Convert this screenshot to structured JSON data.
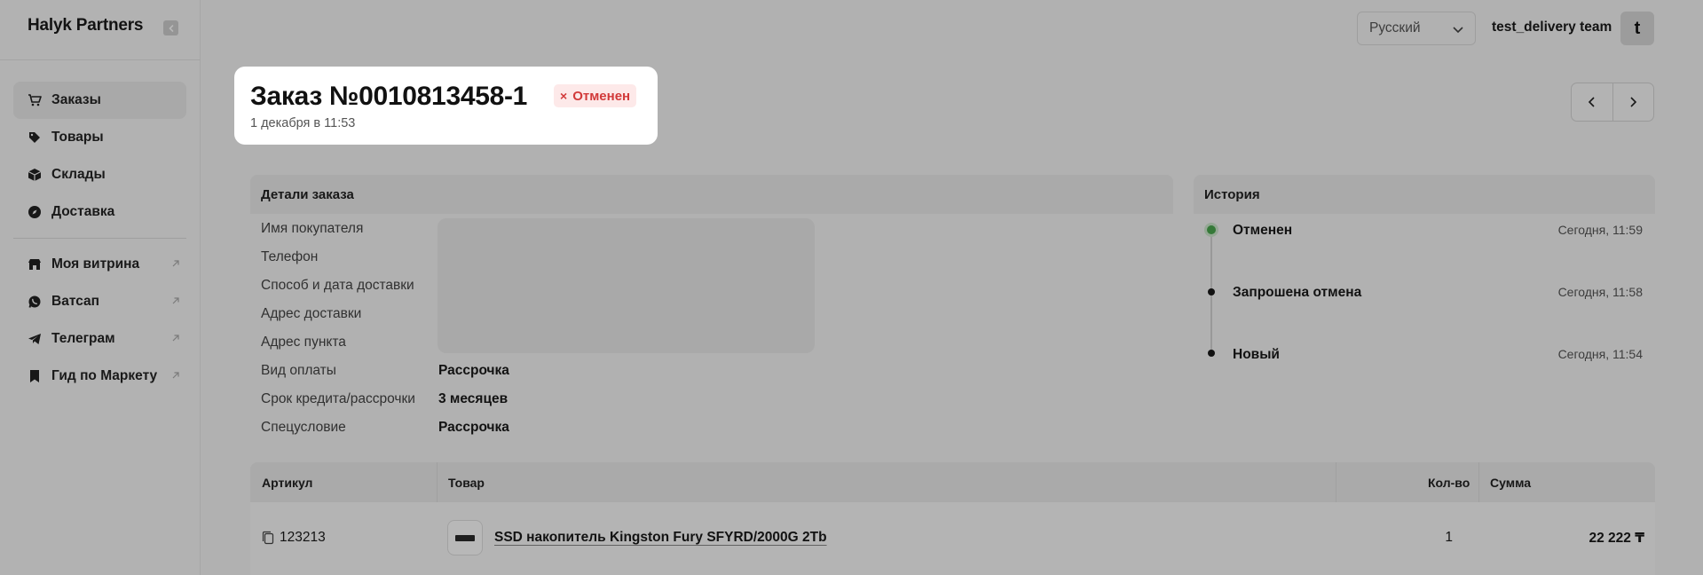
{
  "sidebar": {
    "brand": "Halyk Partners",
    "items": [
      {
        "label": "Заказы",
        "icon": "cart-icon",
        "active": true
      },
      {
        "label": "Товары",
        "icon": "tag-icon"
      },
      {
        "label": "Склады",
        "icon": "box-icon"
      },
      {
        "label": "Доставка",
        "icon": "compass-icon"
      }
    ],
    "links": [
      {
        "label": "Моя витрина",
        "icon": "store-icon"
      },
      {
        "label": "Ватсап",
        "icon": "whatsapp-icon"
      },
      {
        "label": "Телеграм",
        "icon": "telegram-icon"
      },
      {
        "label": "Гид по Маркету",
        "icon": "bookmark-icon"
      }
    ]
  },
  "header": {
    "language": "Русский",
    "team_name": "test_delivery team",
    "avatar_letter": "t"
  },
  "order": {
    "title": "Заказ №0010813458-1",
    "status": "Отменен",
    "status_icon": "×",
    "date": "1 декабря в 11:53"
  },
  "details": {
    "heading": "Детали заказа",
    "rows": [
      {
        "label": "Имя покупателя",
        "value": ""
      },
      {
        "label": "Телефон",
        "value": ""
      },
      {
        "label": "Способ и дата доставки",
        "value": ""
      },
      {
        "label": "Адрес доставки",
        "value": ""
      },
      {
        "label": "Адрес пункта",
        "value": ""
      },
      {
        "label": "Вид оплаты",
        "value": "Рассрочка"
      },
      {
        "label": "Срок кредита/рассрочки",
        "value": "3 месяцев"
      },
      {
        "label": "Спецусловие",
        "value": "Рассрочка"
      }
    ]
  },
  "history": {
    "heading": "История",
    "events": [
      {
        "label": "Отменен",
        "time": "Сегодня, 11:59"
      },
      {
        "label": "Запрошена отмена",
        "time": "Сегодня, 11:58"
      },
      {
        "label": "Новый",
        "time": "Сегодня, 11:54"
      }
    ]
  },
  "items_table": {
    "headers": {
      "sku": "Артикул",
      "product": "Товар",
      "qty": "Кол-во",
      "sum": "Сумма"
    },
    "rows": [
      {
        "sku": "123213",
        "product": "SSD накопитель Kingston Fury SFYRD/2000G 2Tb",
        "qty": "1",
        "sum": "22 222 ₸"
      }
    ]
  },
  "colors": {
    "status_text": "#d23a3a",
    "status_bg": "#fde9e9",
    "history_active": "#4aa84e"
  }
}
